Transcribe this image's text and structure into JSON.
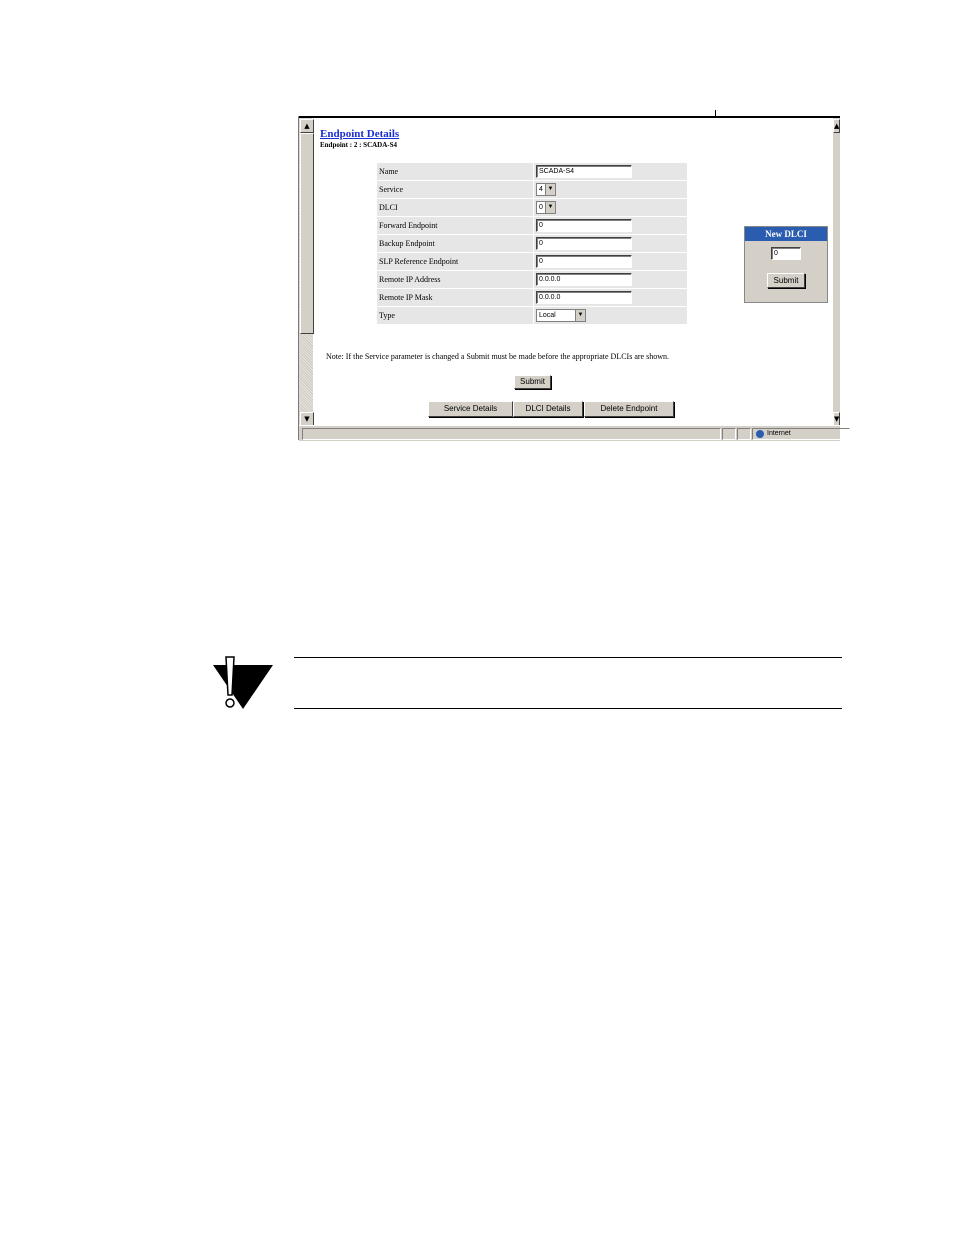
{
  "page": {
    "title": "Endpoint Details",
    "subtitle": "Endpoint : 2 : SCADA-S4"
  },
  "form": {
    "rows": [
      {
        "label": "Name",
        "value": "SCADA-S4",
        "kind": "input"
      },
      {
        "label": "Service",
        "value": "4",
        "kind": "select"
      },
      {
        "label": "DLCI",
        "value": "0",
        "kind": "select"
      },
      {
        "label": "Forward Endpoint",
        "value": "0",
        "kind": "input"
      },
      {
        "label": "Backup Endpoint",
        "value": "0",
        "kind": "input"
      },
      {
        "label": "SLP Reference Endpoint",
        "value": "0",
        "kind": "input"
      },
      {
        "label": "Remote IP Address",
        "value": "0.0.0.0",
        "kind": "input"
      },
      {
        "label": "Remote IP Mask",
        "value": "0.0.0.0",
        "kind": "input"
      },
      {
        "label": "Type",
        "value": "Local",
        "kind": "select"
      }
    ]
  },
  "new_dlci": {
    "title": "New DLCI",
    "value": "0",
    "submit_label": "Submit"
  },
  "note": "Note:  If the Service parameter is changed a Submit must be made before the appropriate DLCIs are shown.",
  "submit_label": "Submit",
  "nav_buttons": {
    "service_details": "Service Details",
    "dlci_details": "DLCI Details",
    "delete_endpoint": "Delete Endpoint"
  },
  "statusbar": {
    "zone": "Internet"
  },
  "icons": {
    "caution": "caution-icon",
    "scroll_up": "scroll-up-arrow-icon",
    "scroll_down": "scroll-down-arrow-icon",
    "zone": "globe-icon"
  },
  "colors": {
    "title_link": "#1a2fd0",
    "panel_header": "#2a5cb0",
    "window_gray": "#d4d0c8"
  }
}
